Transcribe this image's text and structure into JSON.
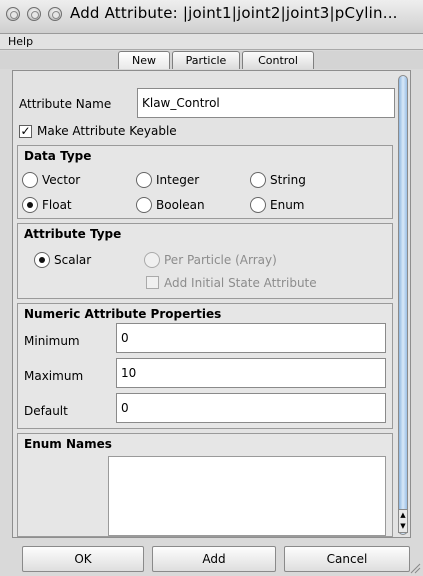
{
  "window": {
    "title": "Add Attribute: |joint1|joint2|joint3|pCylin..."
  },
  "menu": {
    "help_label": "Help"
  },
  "tabs": [
    {
      "label": "New",
      "active": true
    },
    {
      "label": "Particle",
      "active": false
    },
    {
      "label": "Control",
      "active": false
    }
  ],
  "attribute_name": {
    "label": "Attribute Name",
    "value": "Klaw_Control"
  },
  "make_keyable": {
    "label": "Make Attribute Keyable",
    "checked": true
  },
  "data_type": {
    "title": "Data Type",
    "options": [
      {
        "label": "Vector",
        "selected": false
      },
      {
        "label": "Integer",
        "selected": false
      },
      {
        "label": "String",
        "selected": false
      },
      {
        "label": "Float",
        "selected": true
      },
      {
        "label": "Boolean",
        "selected": false
      },
      {
        "label": "Enum",
        "selected": false
      }
    ]
  },
  "attribute_type": {
    "title": "Attribute Type",
    "scalar_label": "Scalar",
    "per_particle_label": "Per Particle (Array)",
    "add_initial_state_label": "Add Initial State Attribute"
  },
  "numeric_props": {
    "title": "Numeric Attribute Properties",
    "minimum_label": "Minimum",
    "minimum_value": "0",
    "maximum_label": "Maximum",
    "maximum_value": "10",
    "default_label": "Default",
    "default_value": "0"
  },
  "enum_names": {
    "title": "Enum Names"
  },
  "buttons": {
    "ok": "OK",
    "add": "Add",
    "cancel": "Cancel"
  },
  "colors": {
    "scrollbar_accent": "#9cc0e6"
  }
}
